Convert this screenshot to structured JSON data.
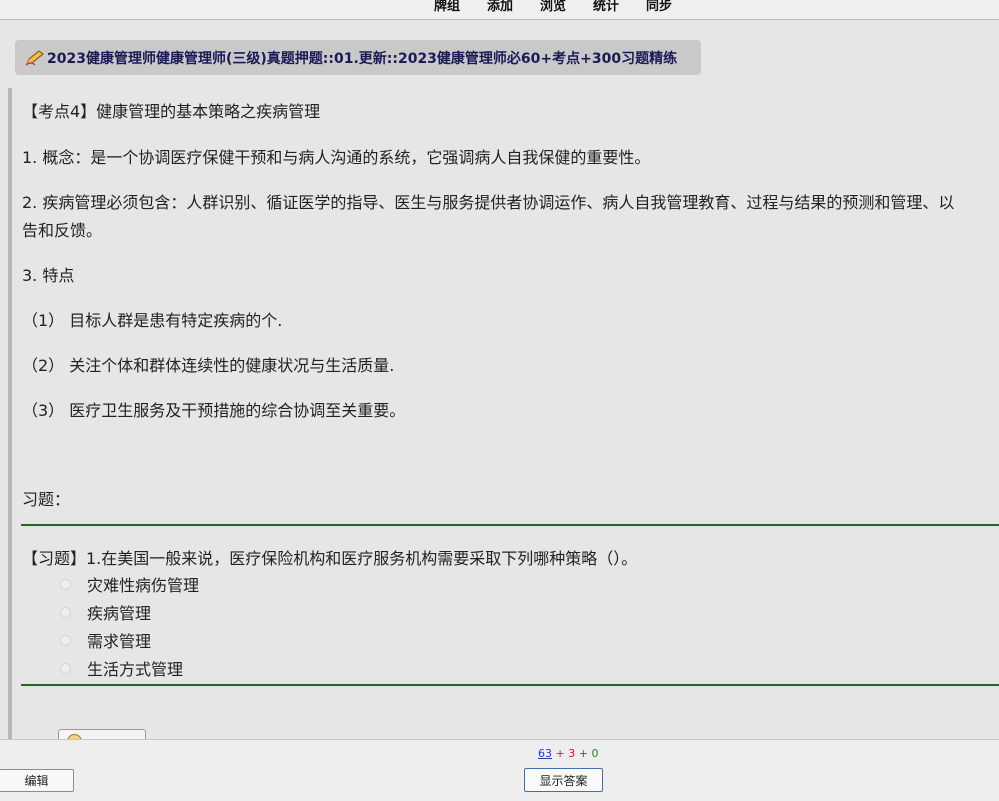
{
  "toolbar": {
    "items": [
      "牌组",
      "添加",
      "浏览",
      "统计",
      "同步"
    ]
  },
  "deck": {
    "title": "2023健康管理师健康管理师(三级)真题押题::01.更新::2023健康管理师必60+考点+300习题精练"
  },
  "card": {
    "heading": "【考点4】健康管理的基本策略之疾病管理",
    "point1": "1. 概念：是一个协调医疗保健干预和与病人沟通的系统，它强调病人自我保健的重要性。",
    "point2_line1": "2. 疾病管理必须包含：人群识别、循证医学的指导、医生与服务提供者协调运作、病人自我管理教育、过程与结果的预测和管理、以",
    "point2_line2": "告和反馈。",
    "point3": "3. 特点",
    "feature1": "（1） 目标人群是患有特定疾病的个.",
    "feature2": "（2） 关注个体和群体连续性的健康状况与生活质量.",
    "feature3": "（3） 医疗卫生服务及干预措施的综合协调至关重要。",
    "exercise_label": "习题：",
    "question": "【习题】1.在美国一般来说，医疗保险机构和医疗服务机构需要采取下列哪种策略（）。",
    "options": [
      "灾难性病伤管理",
      "疾病管理",
      "需求管理",
      "生活方式管理"
    ]
  },
  "bottom": {
    "edit_label": "编辑",
    "show_answer_label": "显示答案",
    "count_new": "63",
    "count_learn": "3",
    "count_review": "0",
    "plus": "+"
  },
  "colors": {
    "accent_new": "#1a3cc8",
    "accent_learn": "#c82020",
    "accent_review": "#1f8a1f",
    "rule_green": "#1d6b1d"
  }
}
